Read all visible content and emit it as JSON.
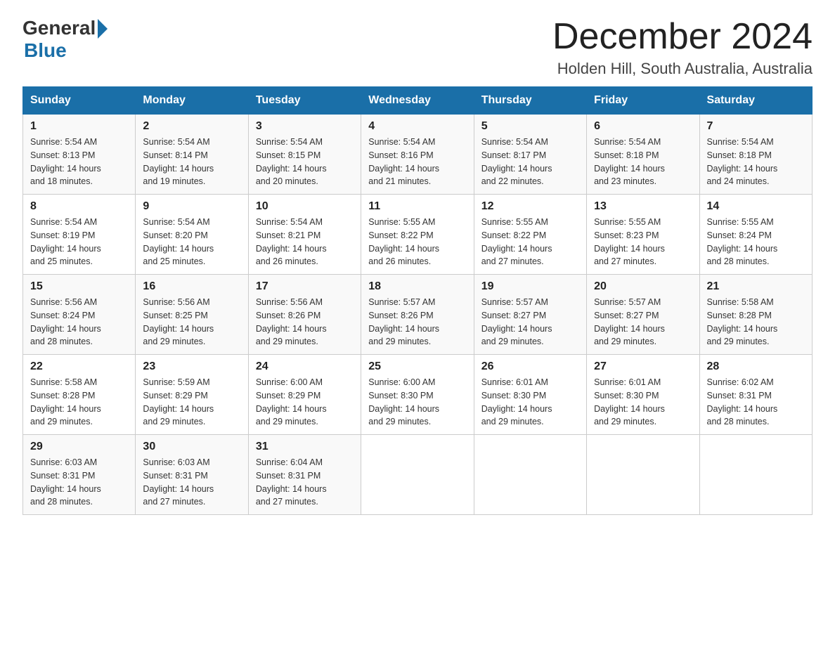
{
  "logo": {
    "general": "General",
    "blue": "Blue"
  },
  "title": "December 2024",
  "subtitle": "Holden Hill, South Australia, Australia",
  "days_of_week": [
    "Sunday",
    "Monday",
    "Tuesday",
    "Wednesday",
    "Thursday",
    "Friday",
    "Saturday"
  ],
  "weeks": [
    [
      {
        "day": "1",
        "sunrise": "5:54 AM",
        "sunset": "8:13 PM",
        "daylight": "14 hours and 18 minutes."
      },
      {
        "day": "2",
        "sunrise": "5:54 AM",
        "sunset": "8:14 PM",
        "daylight": "14 hours and 19 minutes."
      },
      {
        "day": "3",
        "sunrise": "5:54 AM",
        "sunset": "8:15 PM",
        "daylight": "14 hours and 20 minutes."
      },
      {
        "day": "4",
        "sunrise": "5:54 AM",
        "sunset": "8:16 PM",
        "daylight": "14 hours and 21 minutes."
      },
      {
        "day": "5",
        "sunrise": "5:54 AM",
        "sunset": "8:17 PM",
        "daylight": "14 hours and 22 minutes."
      },
      {
        "day": "6",
        "sunrise": "5:54 AM",
        "sunset": "8:18 PM",
        "daylight": "14 hours and 23 minutes."
      },
      {
        "day": "7",
        "sunrise": "5:54 AM",
        "sunset": "8:18 PM",
        "daylight": "14 hours and 24 minutes."
      }
    ],
    [
      {
        "day": "8",
        "sunrise": "5:54 AM",
        "sunset": "8:19 PM",
        "daylight": "14 hours and 25 minutes."
      },
      {
        "day": "9",
        "sunrise": "5:54 AM",
        "sunset": "8:20 PM",
        "daylight": "14 hours and 25 minutes."
      },
      {
        "day": "10",
        "sunrise": "5:54 AM",
        "sunset": "8:21 PM",
        "daylight": "14 hours and 26 minutes."
      },
      {
        "day": "11",
        "sunrise": "5:55 AM",
        "sunset": "8:22 PM",
        "daylight": "14 hours and 26 minutes."
      },
      {
        "day": "12",
        "sunrise": "5:55 AM",
        "sunset": "8:22 PM",
        "daylight": "14 hours and 27 minutes."
      },
      {
        "day": "13",
        "sunrise": "5:55 AM",
        "sunset": "8:23 PM",
        "daylight": "14 hours and 27 minutes."
      },
      {
        "day": "14",
        "sunrise": "5:55 AM",
        "sunset": "8:24 PM",
        "daylight": "14 hours and 28 minutes."
      }
    ],
    [
      {
        "day": "15",
        "sunrise": "5:56 AM",
        "sunset": "8:24 PM",
        "daylight": "14 hours and 28 minutes."
      },
      {
        "day": "16",
        "sunrise": "5:56 AM",
        "sunset": "8:25 PM",
        "daylight": "14 hours and 29 minutes."
      },
      {
        "day": "17",
        "sunrise": "5:56 AM",
        "sunset": "8:26 PM",
        "daylight": "14 hours and 29 minutes."
      },
      {
        "day": "18",
        "sunrise": "5:57 AM",
        "sunset": "8:26 PM",
        "daylight": "14 hours and 29 minutes."
      },
      {
        "day": "19",
        "sunrise": "5:57 AM",
        "sunset": "8:27 PM",
        "daylight": "14 hours and 29 minutes."
      },
      {
        "day": "20",
        "sunrise": "5:57 AM",
        "sunset": "8:27 PM",
        "daylight": "14 hours and 29 minutes."
      },
      {
        "day": "21",
        "sunrise": "5:58 AM",
        "sunset": "8:28 PM",
        "daylight": "14 hours and 29 minutes."
      }
    ],
    [
      {
        "day": "22",
        "sunrise": "5:58 AM",
        "sunset": "8:28 PM",
        "daylight": "14 hours and 29 minutes."
      },
      {
        "day": "23",
        "sunrise": "5:59 AM",
        "sunset": "8:29 PM",
        "daylight": "14 hours and 29 minutes."
      },
      {
        "day": "24",
        "sunrise": "6:00 AM",
        "sunset": "8:29 PM",
        "daylight": "14 hours and 29 minutes."
      },
      {
        "day": "25",
        "sunrise": "6:00 AM",
        "sunset": "8:30 PM",
        "daylight": "14 hours and 29 minutes."
      },
      {
        "day": "26",
        "sunrise": "6:01 AM",
        "sunset": "8:30 PM",
        "daylight": "14 hours and 29 minutes."
      },
      {
        "day": "27",
        "sunrise": "6:01 AM",
        "sunset": "8:30 PM",
        "daylight": "14 hours and 29 minutes."
      },
      {
        "day": "28",
        "sunrise": "6:02 AM",
        "sunset": "8:31 PM",
        "daylight": "14 hours and 28 minutes."
      }
    ],
    [
      {
        "day": "29",
        "sunrise": "6:03 AM",
        "sunset": "8:31 PM",
        "daylight": "14 hours and 28 minutes."
      },
      {
        "day": "30",
        "sunrise": "6:03 AM",
        "sunset": "8:31 PM",
        "daylight": "14 hours and 27 minutes."
      },
      {
        "day": "31",
        "sunrise": "6:04 AM",
        "sunset": "8:31 PM",
        "daylight": "14 hours and 27 minutes."
      },
      null,
      null,
      null,
      null
    ]
  ],
  "labels": {
    "sunrise": "Sunrise:",
    "sunset": "Sunset:",
    "daylight": "Daylight:"
  }
}
